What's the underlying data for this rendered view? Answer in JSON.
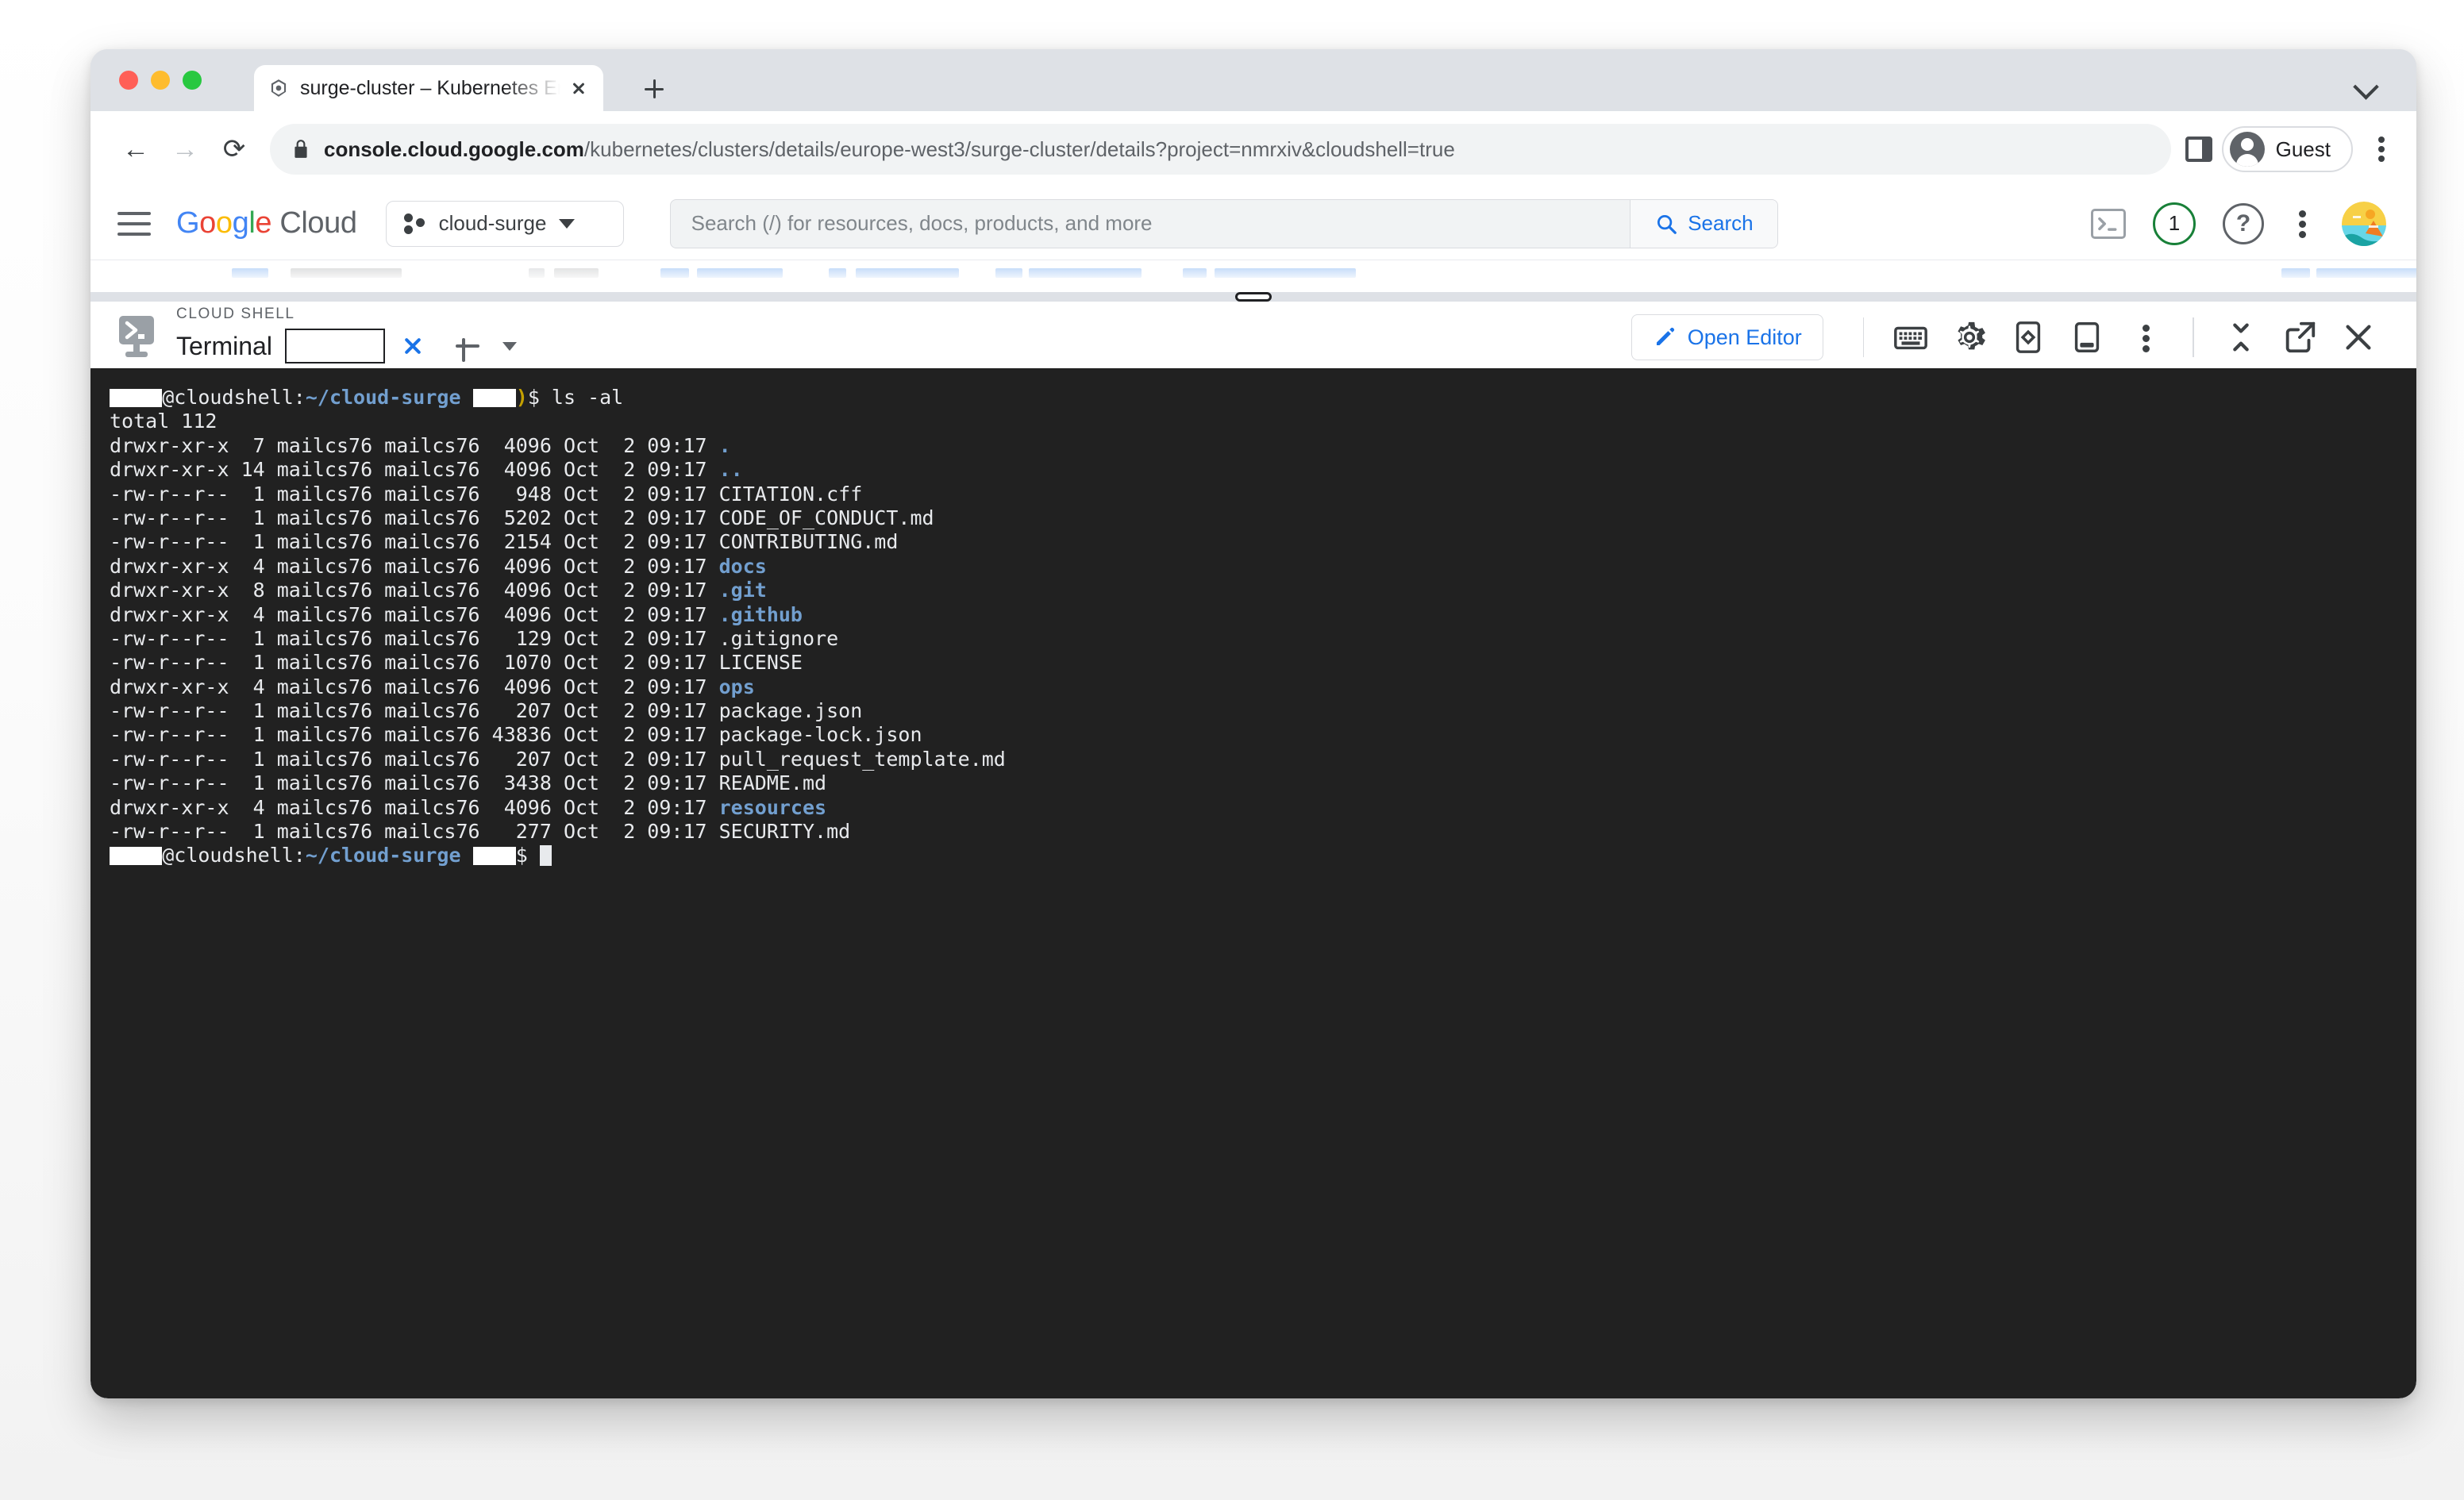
{
  "browser": {
    "tab": {
      "title": "surge-cluster – Kubernetes En",
      "favicon": "gke-hexagon-icon",
      "close_icon": "close-icon"
    },
    "new_tab_icon": "plus-icon",
    "window_chevron_icon": "chevron-down-icon",
    "nav": {
      "back_icon": "back-arrow-icon",
      "forward_icon": "forward-arrow-icon",
      "reload_icon": "reload-icon"
    },
    "omnibox": {
      "lock_icon": "lock-icon",
      "url_domain": "console.cloud.google.com",
      "url_path": "/kubernetes/clusters/details/europe-west3/surge-cluster/details?project=nmrxiv&cloudshell=true"
    },
    "side_panel_icon": "side-panel-icon",
    "profile": {
      "label": "Guest",
      "avatar_icon": "guest-avatar-icon"
    },
    "menu_icon": "browser-menu-icon"
  },
  "console_header": {
    "menu_icon": "hamburger-icon",
    "logo": {
      "google": "Google",
      "cloud": "Cloud"
    },
    "project_picker": {
      "icon": "project-icon",
      "name": "cloud-surge",
      "caret": "chevron-down-icon"
    },
    "search": {
      "placeholder": "Search (/) for resources, docs, products, and more",
      "button_label": "Search",
      "button_icon": "search-icon"
    },
    "actions": {
      "cloud_shell_icon": "cloud-shell-terminal-icon",
      "notifications_count": "1",
      "notifications_icon": "notifications-badge-icon",
      "help_icon": "help-icon",
      "help_glyph": "?",
      "more_icon": "more-vert-icon",
      "avatar_icon": "user-avatar-icon"
    },
    "accent_color": "#1a73e8",
    "notification_ring_color": "#188038"
  },
  "cloud_shell": {
    "resize_handle": "resize-handle",
    "logo_icon": "cloud-shell-logo-icon",
    "eyebrow": "CLOUD SHELL",
    "terminal_label": "Terminal",
    "tab_name_redacted": "",
    "tab_close_icon": "close-icon",
    "add_tab_icon": "plus-icon",
    "add_tab_caret_icon": "chevron-down-icon",
    "open_editor": {
      "label": "Open Editor",
      "icon": "pencil-icon"
    },
    "toolbar_icons": [
      "keyboard-icon",
      "gear-icon",
      "web-preview-icon",
      "open-in-new-window-icon",
      "more-vert-icon",
      "minimize-icon",
      "open-in-new-tab-icon",
      "close-icon"
    ],
    "active_tab_underline_color": "#1a73e8"
  },
  "terminal": {
    "background": "#212121",
    "foreground": "#e8eaed",
    "dir_color": "#729fcf",
    "prompt": {
      "user_redacted": "",
      "host": "@cloudshell:",
      "path": "~/cloud-surge",
      "project_redacted": "",
      "paren": ")",
      "sign": "$"
    },
    "command": "ls -al",
    "total_line": "total 112",
    "listing": [
      {
        "perms": "drwxr-xr-x",
        "links": " 7",
        "owner": "mailcs76",
        "group": "mailcs76",
        "size": " 4096",
        "month": "Oct",
        "day": " 2",
        "time": "09:17",
        "name": ".",
        "is_dir": true
      },
      {
        "perms": "drwxr-xr-x",
        "links": "14",
        "owner": "mailcs76",
        "group": "mailcs76",
        "size": " 4096",
        "month": "Oct",
        "day": " 2",
        "time": "09:17",
        "name": "..",
        "is_dir": true
      },
      {
        "perms": "-rw-r--r--",
        "links": " 1",
        "owner": "mailcs76",
        "group": "mailcs76",
        "size": "  948",
        "month": "Oct",
        "day": " 2",
        "time": "09:17",
        "name": "CITATION.cff",
        "is_dir": false
      },
      {
        "perms": "-rw-r--r--",
        "links": " 1",
        "owner": "mailcs76",
        "group": "mailcs76",
        "size": " 5202",
        "month": "Oct",
        "day": " 2",
        "time": "09:17",
        "name": "CODE_OF_CONDUCT.md",
        "is_dir": false
      },
      {
        "perms": "-rw-r--r--",
        "links": " 1",
        "owner": "mailcs76",
        "group": "mailcs76",
        "size": " 2154",
        "month": "Oct",
        "day": " 2",
        "time": "09:17",
        "name": "CONTRIBUTING.md",
        "is_dir": false
      },
      {
        "perms": "drwxr-xr-x",
        "links": " 4",
        "owner": "mailcs76",
        "group": "mailcs76",
        "size": " 4096",
        "month": "Oct",
        "day": " 2",
        "time": "09:17",
        "name": "docs",
        "is_dir": true
      },
      {
        "perms": "drwxr-xr-x",
        "links": " 8",
        "owner": "mailcs76",
        "group": "mailcs76",
        "size": " 4096",
        "month": "Oct",
        "day": " 2",
        "time": "09:17",
        "name": ".git",
        "is_dir": true
      },
      {
        "perms": "drwxr-xr-x",
        "links": " 4",
        "owner": "mailcs76",
        "group": "mailcs76",
        "size": " 4096",
        "month": "Oct",
        "day": " 2",
        "time": "09:17",
        "name": ".github",
        "is_dir": true
      },
      {
        "perms": "-rw-r--r--",
        "links": " 1",
        "owner": "mailcs76",
        "group": "mailcs76",
        "size": "  129",
        "month": "Oct",
        "day": " 2",
        "time": "09:17",
        "name": ".gitignore",
        "is_dir": false
      },
      {
        "perms": "-rw-r--r--",
        "links": " 1",
        "owner": "mailcs76",
        "group": "mailcs76",
        "size": " 1070",
        "month": "Oct",
        "day": " 2",
        "time": "09:17",
        "name": "LICENSE",
        "is_dir": false
      },
      {
        "perms": "drwxr-xr-x",
        "links": " 4",
        "owner": "mailcs76",
        "group": "mailcs76",
        "size": " 4096",
        "month": "Oct",
        "day": " 2",
        "time": "09:17",
        "name": "ops",
        "is_dir": true
      },
      {
        "perms": "-rw-r--r--",
        "links": " 1",
        "owner": "mailcs76",
        "group": "mailcs76",
        "size": "  207",
        "month": "Oct",
        "day": " 2",
        "time": "09:17",
        "name": "package.json",
        "is_dir": false
      },
      {
        "perms": "-rw-r--r--",
        "links": " 1",
        "owner": "mailcs76",
        "group": "mailcs76",
        "size": "43836",
        "month": "Oct",
        "day": " 2",
        "time": "09:17",
        "name": "package-lock.json",
        "is_dir": false
      },
      {
        "perms": "-rw-r--r--",
        "links": " 1",
        "owner": "mailcs76",
        "group": "mailcs76",
        "size": "  207",
        "month": "Oct",
        "day": " 2",
        "time": "09:17",
        "name": "pull_request_template.md",
        "is_dir": false
      },
      {
        "perms": "-rw-r--r--",
        "links": " 1",
        "owner": "mailcs76",
        "group": "mailcs76",
        "size": " 3438",
        "month": "Oct",
        "day": " 2",
        "time": "09:17",
        "name": "README.md",
        "is_dir": false
      },
      {
        "perms": "drwxr-xr-x",
        "links": " 4",
        "owner": "mailcs76",
        "group": "mailcs76",
        "size": " 4096",
        "month": "Oct",
        "day": " 2",
        "time": "09:17",
        "name": "resources",
        "is_dir": true
      },
      {
        "perms": "-rw-r--r--",
        "links": " 1",
        "owner": "mailcs76",
        "group": "mailcs76",
        "size": "  277",
        "month": "Oct",
        "day": " 2",
        "time": "09:17",
        "name": "SECURITY.md",
        "is_dir": false
      }
    ]
  }
}
